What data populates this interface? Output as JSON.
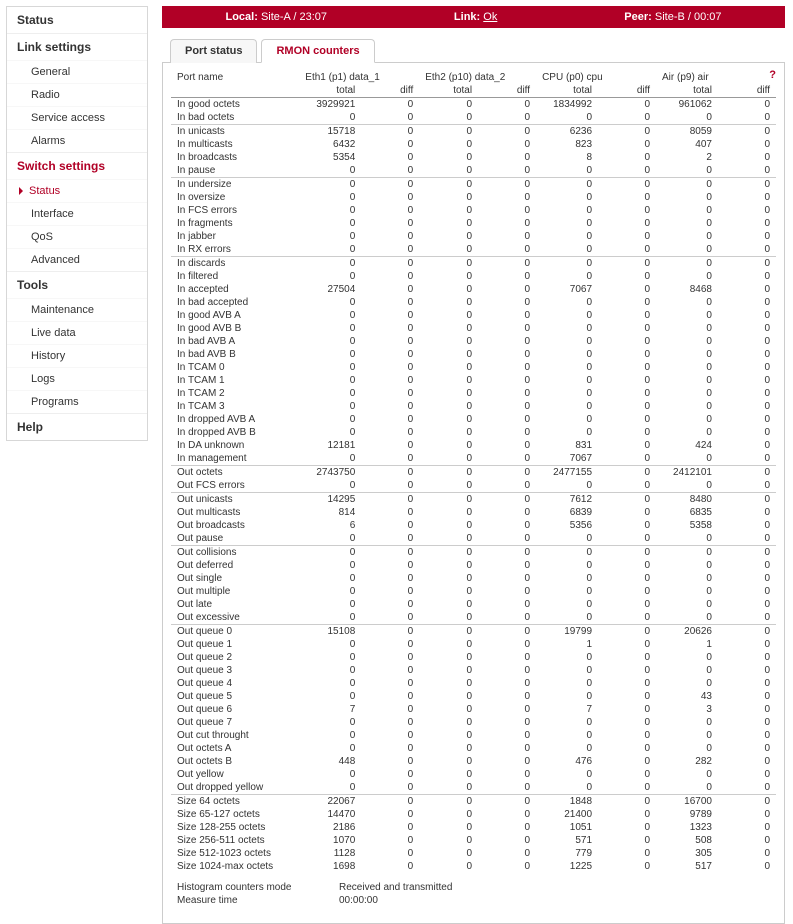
{
  "sidebar": {
    "groups": [
      {
        "title": "Status",
        "items": []
      },
      {
        "title": "Link settings",
        "items": [
          {
            "label": "General"
          },
          {
            "label": "Radio"
          },
          {
            "label": "Service access"
          },
          {
            "label": "Alarms"
          }
        ]
      },
      {
        "title": "Switch settings",
        "red": true,
        "items": [
          {
            "label": "Status",
            "active": true
          },
          {
            "label": "Interface"
          },
          {
            "label": "QoS"
          },
          {
            "label": "Advanced"
          }
        ]
      },
      {
        "title": "Tools",
        "items": [
          {
            "label": "Maintenance"
          },
          {
            "label": "Live data"
          },
          {
            "label": "History"
          },
          {
            "label": "Logs"
          },
          {
            "label": "Programs"
          }
        ]
      },
      {
        "title": "Help",
        "items": []
      }
    ]
  },
  "topbar": {
    "local_label": "Local:",
    "local_value": "Site-A / 23:07",
    "link_label": "Link:",
    "link_value": "Ok",
    "peer_label": "Peer:",
    "peer_value": "Site-B / 00:07"
  },
  "tabs": [
    {
      "label": "Port status"
    },
    {
      "label": "RMON counters",
      "active": true
    }
  ],
  "help_icon": "?",
  "ports": [
    {
      "name": "Eth1 (p1) data_1"
    },
    {
      "name": "Eth2 (p10) data_2"
    },
    {
      "name": "CPU (p0) cpu"
    },
    {
      "name": "Air (p9) air"
    }
  ],
  "col_labels": {
    "portname": "Port name",
    "total": "total",
    "diff": "diff"
  },
  "sections": [
    [
      {
        "label": "In good octets",
        "v": [
          3929921,
          0,
          0,
          0,
          1834992,
          0,
          961062,
          0
        ]
      },
      {
        "label": "In bad octets",
        "v": [
          0,
          0,
          0,
          0,
          0,
          0,
          0,
          0
        ]
      }
    ],
    [
      {
        "label": "In unicasts",
        "v": [
          15718,
          0,
          0,
          0,
          6236,
          0,
          8059,
          0
        ]
      },
      {
        "label": "In multicasts",
        "v": [
          6432,
          0,
          0,
          0,
          823,
          0,
          407,
          0
        ]
      },
      {
        "label": "In broadcasts",
        "v": [
          5354,
          0,
          0,
          0,
          8,
          0,
          2,
          0
        ]
      },
      {
        "label": "In pause",
        "v": [
          0,
          0,
          0,
          0,
          0,
          0,
          0,
          0
        ]
      }
    ],
    [
      {
        "label": "In undersize",
        "v": [
          0,
          0,
          0,
          0,
          0,
          0,
          0,
          0
        ]
      },
      {
        "label": "In oversize",
        "v": [
          0,
          0,
          0,
          0,
          0,
          0,
          0,
          0
        ]
      },
      {
        "label": "In FCS errors",
        "v": [
          0,
          0,
          0,
          0,
          0,
          0,
          0,
          0
        ]
      },
      {
        "label": "In fragments",
        "v": [
          0,
          0,
          0,
          0,
          0,
          0,
          0,
          0
        ]
      },
      {
        "label": "In jabber",
        "v": [
          0,
          0,
          0,
          0,
          0,
          0,
          0,
          0
        ]
      },
      {
        "label": "In RX errors",
        "v": [
          0,
          0,
          0,
          0,
          0,
          0,
          0,
          0
        ]
      }
    ],
    [
      {
        "label": "In discards",
        "v": [
          0,
          0,
          0,
          0,
          0,
          0,
          0,
          0
        ]
      },
      {
        "label": "In filtered",
        "v": [
          0,
          0,
          0,
          0,
          0,
          0,
          0,
          0
        ]
      },
      {
        "label": "In accepted",
        "v": [
          27504,
          0,
          0,
          0,
          7067,
          0,
          8468,
          0
        ]
      },
      {
        "label": "In bad accepted",
        "v": [
          0,
          0,
          0,
          0,
          0,
          0,
          0,
          0
        ]
      },
      {
        "label": "In good AVB A",
        "v": [
          0,
          0,
          0,
          0,
          0,
          0,
          0,
          0
        ]
      },
      {
        "label": "In good AVB B",
        "v": [
          0,
          0,
          0,
          0,
          0,
          0,
          0,
          0
        ]
      },
      {
        "label": "In bad AVB A",
        "v": [
          0,
          0,
          0,
          0,
          0,
          0,
          0,
          0
        ]
      },
      {
        "label": "In bad AVB B",
        "v": [
          0,
          0,
          0,
          0,
          0,
          0,
          0,
          0
        ]
      },
      {
        "label": "In TCAM 0",
        "v": [
          0,
          0,
          0,
          0,
          0,
          0,
          0,
          0
        ]
      },
      {
        "label": "In TCAM 1",
        "v": [
          0,
          0,
          0,
          0,
          0,
          0,
          0,
          0
        ]
      },
      {
        "label": "In TCAM 2",
        "v": [
          0,
          0,
          0,
          0,
          0,
          0,
          0,
          0
        ]
      },
      {
        "label": "In TCAM 3",
        "v": [
          0,
          0,
          0,
          0,
          0,
          0,
          0,
          0
        ]
      },
      {
        "label": "In dropped AVB A",
        "v": [
          0,
          0,
          0,
          0,
          0,
          0,
          0,
          0
        ]
      },
      {
        "label": "In dropped AVB B",
        "v": [
          0,
          0,
          0,
          0,
          0,
          0,
          0,
          0
        ]
      },
      {
        "label": "In DA unknown",
        "v": [
          12181,
          0,
          0,
          0,
          831,
          0,
          424,
          0
        ]
      },
      {
        "label": "In management",
        "v": [
          0,
          0,
          0,
          0,
          7067,
          0,
          0,
          0
        ]
      }
    ],
    [
      {
        "label": "Out octets",
        "v": [
          2743750,
          0,
          0,
          0,
          2477155,
          0,
          2412101,
          0
        ]
      },
      {
        "label": "Out FCS errors",
        "v": [
          0,
          0,
          0,
          0,
          0,
          0,
          0,
          0
        ]
      }
    ],
    [
      {
        "label": "Out unicasts",
        "v": [
          14295,
          0,
          0,
          0,
          7612,
          0,
          8480,
          0
        ]
      },
      {
        "label": "Out multicasts",
        "v": [
          814,
          0,
          0,
          0,
          6839,
          0,
          6835,
          0
        ]
      },
      {
        "label": "Out broadcasts",
        "v": [
          6,
          0,
          0,
          0,
          5356,
          0,
          5358,
          0
        ]
      },
      {
        "label": "Out pause",
        "v": [
          0,
          0,
          0,
          0,
          0,
          0,
          0,
          0
        ]
      }
    ],
    [
      {
        "label": "Out collisions",
        "v": [
          0,
          0,
          0,
          0,
          0,
          0,
          0,
          0
        ]
      },
      {
        "label": "Out deferred",
        "v": [
          0,
          0,
          0,
          0,
          0,
          0,
          0,
          0
        ]
      },
      {
        "label": "Out single",
        "v": [
          0,
          0,
          0,
          0,
          0,
          0,
          0,
          0
        ]
      },
      {
        "label": "Out multiple",
        "v": [
          0,
          0,
          0,
          0,
          0,
          0,
          0,
          0
        ]
      },
      {
        "label": "Out late",
        "v": [
          0,
          0,
          0,
          0,
          0,
          0,
          0,
          0
        ]
      },
      {
        "label": "Out excessive",
        "v": [
          0,
          0,
          0,
          0,
          0,
          0,
          0,
          0
        ]
      }
    ],
    [
      {
        "label": "Out queue 0",
        "v": [
          15108,
          0,
          0,
          0,
          19799,
          0,
          20626,
          0
        ]
      },
      {
        "label": "Out queue 1",
        "v": [
          0,
          0,
          0,
          0,
          1,
          0,
          1,
          0
        ]
      },
      {
        "label": "Out queue 2",
        "v": [
          0,
          0,
          0,
          0,
          0,
          0,
          0,
          0
        ]
      },
      {
        "label": "Out queue 3",
        "v": [
          0,
          0,
          0,
          0,
          0,
          0,
          0,
          0
        ]
      },
      {
        "label": "Out queue 4",
        "v": [
          0,
          0,
          0,
          0,
          0,
          0,
          0,
          0
        ]
      },
      {
        "label": "Out queue 5",
        "v": [
          0,
          0,
          0,
          0,
          0,
          0,
          43,
          0
        ]
      },
      {
        "label": "Out queue 6",
        "v": [
          7,
          0,
          0,
          0,
          7,
          0,
          3,
          0
        ]
      },
      {
        "label": "Out queue 7",
        "v": [
          0,
          0,
          0,
          0,
          0,
          0,
          0,
          0
        ]
      },
      {
        "label": "Out cut throught",
        "v": [
          0,
          0,
          0,
          0,
          0,
          0,
          0,
          0
        ]
      },
      {
        "label": "Out octets A",
        "v": [
          0,
          0,
          0,
          0,
          0,
          0,
          0,
          0
        ]
      },
      {
        "label": "Out octets B",
        "v": [
          448,
          0,
          0,
          0,
          476,
          0,
          282,
          0
        ]
      },
      {
        "label": "Out yellow",
        "v": [
          0,
          0,
          0,
          0,
          0,
          0,
          0,
          0
        ]
      },
      {
        "label": "Out dropped yellow",
        "v": [
          0,
          0,
          0,
          0,
          0,
          0,
          0,
          0
        ]
      }
    ],
    [
      {
        "label": "Size 64 octets",
        "v": [
          22067,
          0,
          0,
          0,
          1848,
          0,
          16700,
          0
        ]
      },
      {
        "label": "Size 65-127 octets",
        "v": [
          14470,
          0,
          0,
          0,
          21400,
          0,
          9789,
          0
        ]
      },
      {
        "label": "Size 128-255 octets",
        "v": [
          2186,
          0,
          0,
          0,
          1051,
          0,
          1323,
          0
        ]
      },
      {
        "label": "Size 256-511 octets",
        "v": [
          1070,
          0,
          0,
          0,
          571,
          0,
          508,
          0
        ]
      },
      {
        "label": "Size 512-1023 octets",
        "v": [
          1128,
          0,
          0,
          0,
          779,
          0,
          305,
          0
        ]
      },
      {
        "label": "Size 1024-max octets",
        "v": [
          1698,
          0,
          0,
          0,
          1225,
          0,
          517,
          0
        ]
      }
    ]
  ],
  "footer": {
    "hist_label": "Histogram counters mode",
    "hist_value": "Received and transmitted",
    "time_label": "Measure time",
    "time_value": "00:00:00"
  }
}
